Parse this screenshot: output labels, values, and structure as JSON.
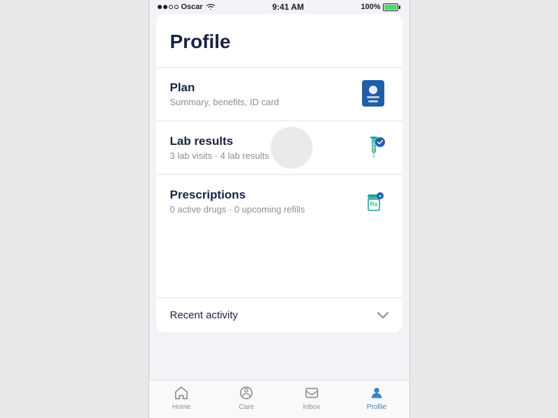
{
  "statusBar": {
    "carrier": "Oscar",
    "time": "9:41 AM",
    "battery": "100%"
  },
  "page": {
    "title": "Profile"
  },
  "menuItems": [
    {
      "id": "plan",
      "title": "Plan",
      "subtitle": "Summary, benefits, ID card"
    },
    {
      "id": "lab-results",
      "title": "Lab results",
      "subtitle": "3 lab visits · 4 lab results"
    },
    {
      "id": "prescriptions",
      "title": "Prescriptions",
      "subtitle": "0 active drugs · 0 upcoming refills"
    }
  ],
  "recentActivity": {
    "label": "Recent activity",
    "chevron": "∨"
  },
  "tabBar": {
    "items": [
      {
        "id": "home",
        "label": "Home",
        "active": false
      },
      {
        "id": "care",
        "label": "Care",
        "active": false
      },
      {
        "id": "inbox",
        "label": "Inbox",
        "active": false
      },
      {
        "id": "profile",
        "label": "Profile",
        "active": true
      }
    ]
  },
  "colors": {
    "accent": "#3b82c4",
    "titleColor": "#1a2340",
    "subtitleColor": "#8e8e93"
  }
}
